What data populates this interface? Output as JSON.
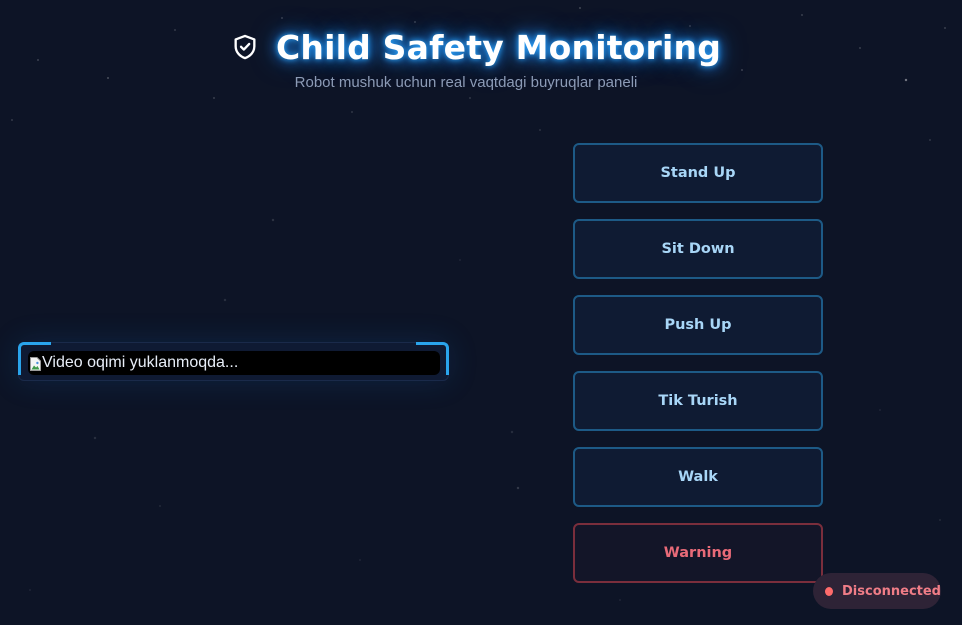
{
  "header": {
    "title": "Child Safety Monitoring",
    "subtitle": "Robot mushuk uchun real vaqtdagi buyruqlar paneli",
    "icon": "shield-check-icon"
  },
  "video": {
    "alt_text": "Video oqimi yuklanmoqda...",
    "accent_color": "#2aa4ec"
  },
  "controls": {
    "buttons": [
      {
        "label": "Stand Up",
        "variant": "default"
      },
      {
        "label": "Sit Down",
        "variant": "default"
      },
      {
        "label": "Push Up",
        "variant": "default"
      },
      {
        "label": "Tik Turish",
        "variant": "default"
      },
      {
        "label": "Walk",
        "variant": "default"
      },
      {
        "label": "Warning",
        "variant": "danger"
      }
    ],
    "colors": {
      "default_border": "#1d5a86",
      "default_text": "#a8d6f7",
      "danger_border": "#7a2e3c",
      "danger_text": "#e86a78"
    }
  },
  "status": {
    "text": "Disconnected",
    "color": "#ff6b6b"
  },
  "colors": {
    "background": "#0d1426",
    "title_glow": "#2ea8ff"
  }
}
